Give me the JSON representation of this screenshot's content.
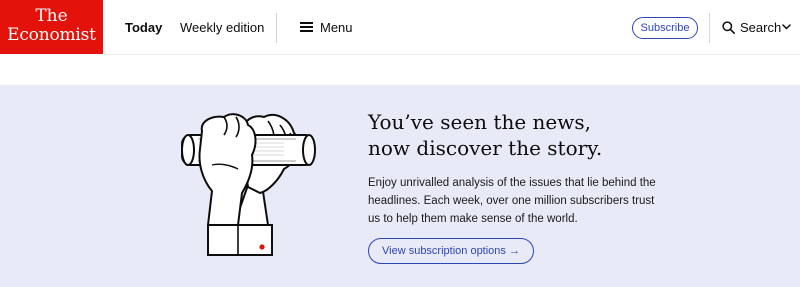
{
  "brand": {
    "line1": "The",
    "line2": "Economist",
    "color": "#e3120b"
  },
  "nav": {
    "today": "Today",
    "weekly_edition": "Weekly edition",
    "menu": "Menu",
    "menu_icon": "hamburger-icon"
  },
  "actions": {
    "subscribe": "Subscribe",
    "search": "Search",
    "search_icon": "search-icon",
    "chevron_icon": "chevron-down-icon",
    "accent_color": "#2e45b8"
  },
  "promo": {
    "headline_line1": "You’ve seen the news,",
    "headline_line2": "now discover the story.",
    "body": "Enjoy unrivalled analysis of the issues that lie behind the headlines. Each week, over one million subscribers trust us to help them make sense of the world.",
    "cta": "View subscription options →",
    "background": "#e8ebf7",
    "illustration": "hands-holding-newspaper-illustration"
  }
}
